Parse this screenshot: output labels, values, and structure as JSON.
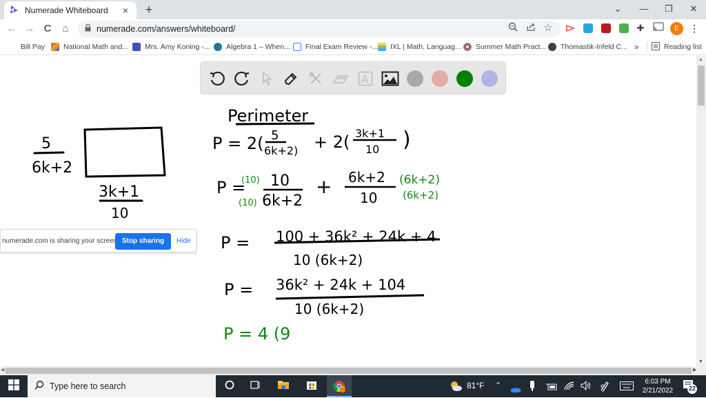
{
  "browser": {
    "tab": {
      "title": "Numerade Whiteboard",
      "close": "×"
    },
    "new_tab": "+",
    "window_controls": {
      "dropdown": "⌄",
      "minimize": "—",
      "restore": "❐",
      "close": "✕"
    },
    "nav": {
      "back": "←",
      "forward": "→",
      "reload": "C",
      "home": "⌂"
    },
    "url": "numerade.com/answers/whiteboard/",
    "lock": "🔒",
    "profile_initial": "E",
    "more": "⋮",
    "bookmarks": [
      {
        "label": "Bill Pay",
        "icon_color": ""
      },
      {
        "label": "National Math and...",
        "icon_color": "#e8462a"
      },
      {
        "label": "Mrs. Amy Koning -...",
        "icon_color": "#3f51b5"
      },
      {
        "label": "Algebra 1 – When...",
        "icon_color": "#21759b"
      },
      {
        "label": "Final Exam Review -...",
        "icon_color": "#4285f4"
      },
      {
        "label": "IXL | Math, Languag...",
        "icon_color": "#8bc34a"
      },
      {
        "label": "Summer Math Pract...",
        "icon_color": "#b0453a"
      },
      {
        "label": "Thomastik-Infeld C...",
        "icon_color": "#3c4043"
      }
    ],
    "bookmarks_overflow": "»",
    "reading_list": "Reading list"
  },
  "whiteboard": {
    "tools": [
      "undo",
      "redo",
      "select",
      "pen",
      "shapes",
      "eraser",
      "text",
      "image"
    ],
    "colors": [
      "#a9a9a9",
      "#e6a9a9",
      "#008000",
      "#b3b3e6"
    ],
    "active_color": "#008000",
    "content": {
      "rect_side_num": "5",
      "rect_side_den": "6k+2",
      "rect_bottom_num": "3k+1",
      "rect_bottom_den": "10",
      "heading": "Perimeter",
      "line1": "P = 2(5/(6k+2)) + 2(3k+1 / 10)",
      "line1_parts": {
        "p": "P = 2(",
        "frac1_num": "5",
        "frac1_den": "6k+2)",
        "mid": "+ 2(",
        "frac2_num": "3k+1",
        "frac2_den": "10",
        "close": ")"
      },
      "line2_parts": {
        "p": "P =",
        "mult_top": "(10)",
        "mult_bot": "(10)",
        "frac1_num": "10",
        "frac1_den": "6k+2",
        "plus": "+",
        "frac2_num": "6k+2",
        "frac2_den": "10",
        "mult2_top": "(6k+2)",
        "mult2_bot": "(6k+2)"
      },
      "line3_parts": {
        "p": "P =",
        "num": "100 + 36k² + 24k + 4",
        "den": "10 (6k+2)"
      },
      "line4_parts": {
        "p": "P =",
        "num": "36k² + 24k + 104",
        "den": "10 (6k+2)"
      },
      "line5": "P = 4 (9"
    }
  },
  "share_bar": {
    "message": "numerade.com is sharing your screen.",
    "stop_label": "Stop sharing",
    "hide_label": "Hide"
  },
  "taskbar": {
    "search_placeholder": "Type here to search",
    "weather": "81°F",
    "time": "6:03 PM",
    "date": "2/21/2022",
    "notifications": "22"
  }
}
